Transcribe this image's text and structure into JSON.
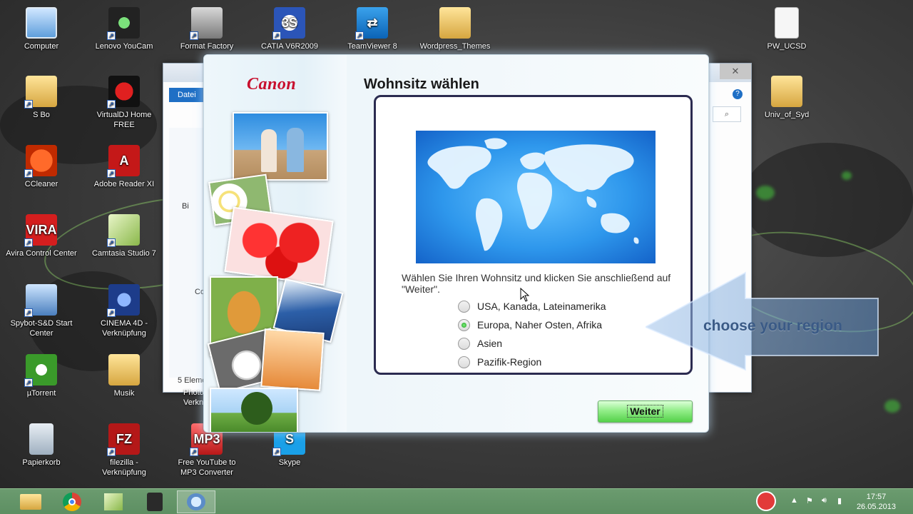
{
  "desktop": {
    "icons": [
      {
        "label": "Computer",
        "glyph": "computer-icon"
      },
      {
        "label": "Lenovo YouCam",
        "glyph": "webcam-icon"
      },
      {
        "label": "Format Factory",
        "glyph": "format-factory-icon"
      },
      {
        "label": "CATIA V6R2009",
        "glyph": "catia-icon"
      },
      {
        "label": "TeamViewer 8",
        "glyph": "teamviewer-icon"
      },
      {
        "label": "Wordpress_Themes",
        "glyph": "folder-icon"
      },
      {
        "label": "PW_UCSD",
        "glyph": "document-icon"
      },
      {
        "label": "S Bo",
        "glyph": "user-folder-icon"
      },
      {
        "label": "VirtualDJ Home FREE",
        "glyph": "virtualdj-icon"
      },
      {
        "label": "Univ_of_Syd",
        "glyph": "folder-icon"
      },
      {
        "label": "CCleaner",
        "glyph": "ccleaner-icon"
      },
      {
        "label": "Adobe Reader XI",
        "glyph": "adobe-reader-icon"
      },
      {
        "label": "Avira Control Center",
        "glyph": "avira-icon"
      },
      {
        "label": "Camtasia Studio 7",
        "glyph": "camtasia-icon"
      },
      {
        "label": "Spybot-S&D Start Center",
        "glyph": "spybot-icon"
      },
      {
        "label": "CINEMA 4D - Verknüpfung",
        "glyph": "cinema4d-icon"
      },
      {
        "label": "µTorrent",
        "glyph": "utorrent-icon"
      },
      {
        "label": "Musik",
        "glyph": "folder-icon"
      },
      {
        "label": "Papierkorb",
        "glyph": "recycle-bin-icon"
      },
      {
        "label": "filezilla - Verknüpfung",
        "glyph": "filezilla-icon"
      },
      {
        "label": "Free YouTube to MP3 Converter",
        "glyph": "mp3-converter-icon"
      },
      {
        "label": "Skype",
        "glyph": "skype-icon"
      }
    ]
  },
  "explorer": {
    "ribbon_tab": "Datei",
    "nav_item_1": "Bi",
    "nav_item_2": "Co",
    "status_text": "5 Eleme",
    "partial_label": "Verkn",
    "partial_label_2": "Photo"
  },
  "installer": {
    "brand": "Canon",
    "title": "Wohnsitz wählen",
    "instructions": "Wählen Sie Ihren Wohnsitz und klicken Sie anschließend auf \"Weiter\".",
    "regions": [
      {
        "label": "USA, Kanada, Lateinamerika",
        "checked": false
      },
      {
        "label": "Europa, Naher Osten, Afrika",
        "checked": true
      },
      {
        "label": "Asien",
        "checked": false
      },
      {
        "label": "Pazifik-Region",
        "checked": false
      }
    ],
    "next_button": "Weiter"
  },
  "overlay": {
    "callout_text": "choose your region"
  },
  "taskbar": {
    "time": "17:57",
    "date": "26.05.2013"
  },
  "colors": {
    "canon_red": "#c8102e",
    "button_green": "#55d14a",
    "taskbar_green": "#6b9b6f"
  }
}
